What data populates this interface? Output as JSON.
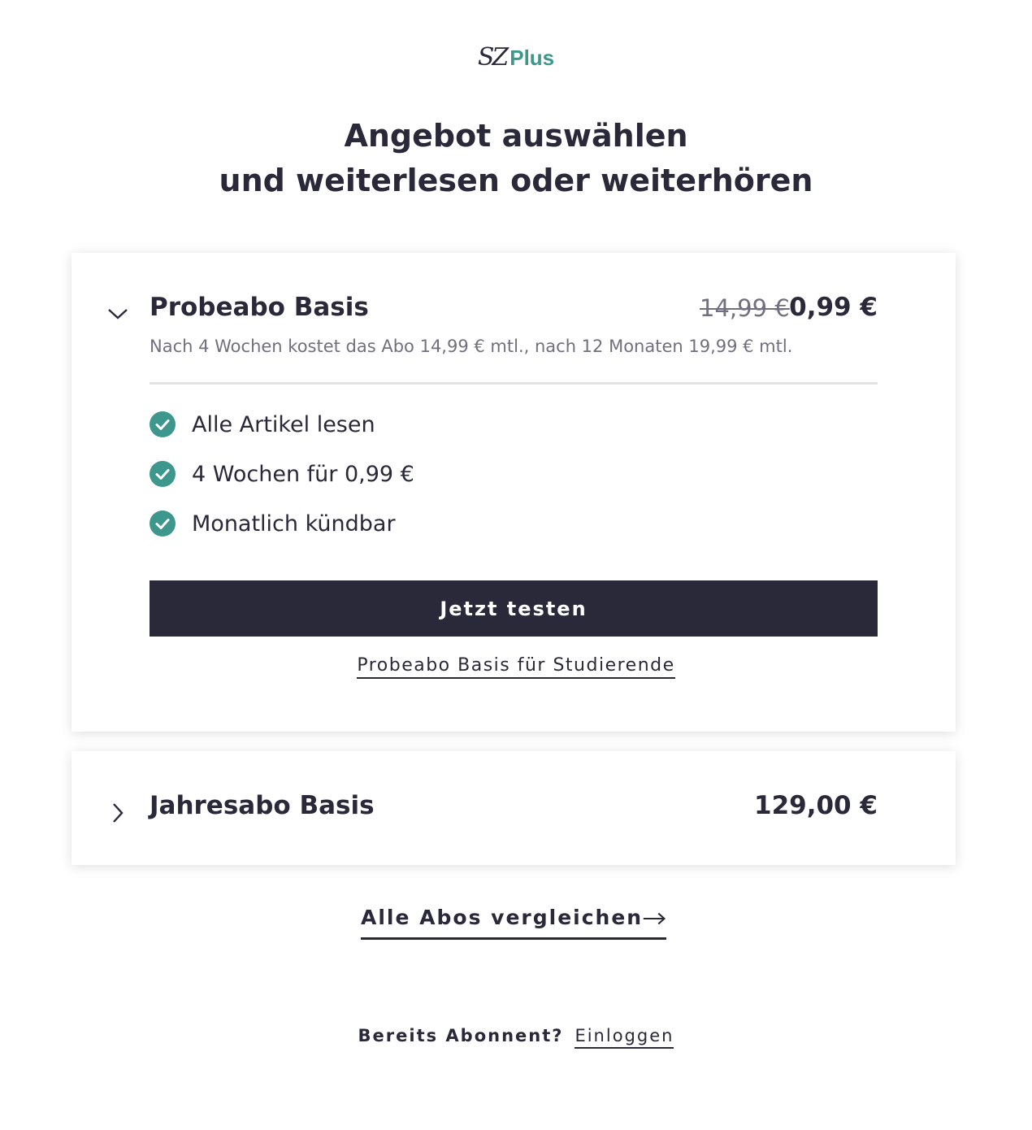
{
  "logo": {
    "brand": "SZ",
    "suffix": "Plus"
  },
  "headline": {
    "line1": "Angebot auswählen",
    "line2": "und weiterlesen oder weiterhören"
  },
  "offers": [
    {
      "title": "Probeabo Basis",
      "old_price": "14,99 €",
      "price": "0,99 €",
      "expanded": true,
      "description": "Nach 4 Wochen kostet das Abo 14,99 € mtl., nach 12 Monaten 19,99 € mtl.",
      "features": [
        "Alle Artikel lesen",
        "4 Wochen für 0,99 €",
        "Monatlich kündbar"
      ],
      "cta_label": "Jetzt testen",
      "student_link": "Probeabo Basis für Studierende"
    },
    {
      "title": "Jahresabo Basis",
      "price": "129,00 €",
      "expanded": false
    }
  ],
  "compare_link": "Alle Abos vergleichen",
  "login": {
    "question": "Bereits Abonnent?",
    "link": "Einloggen"
  },
  "colors": {
    "accent": "#3d978c",
    "dark": "#29293a",
    "muted": "#70707f"
  },
  "icons": {
    "expanded": "chevron-down-icon",
    "collapsed": "chevron-right-icon",
    "feature": "check-circle-icon",
    "compare": "arrow-right-icon"
  }
}
